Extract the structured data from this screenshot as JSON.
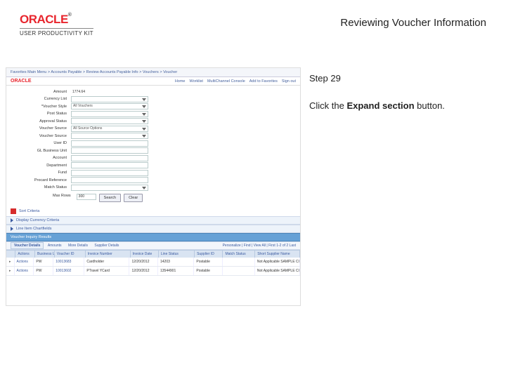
{
  "header": {
    "brand": "ORACLE",
    "brand_tm": "®",
    "subbrand": "USER PRODUCTIVITY KIT",
    "title": "Reviewing Voucher Information"
  },
  "side": {
    "step_label": "Step 29",
    "instruction_pre": "Click the ",
    "instruction_bold": "Expand section",
    "instruction_post": " button."
  },
  "shot": {
    "breadcrumb": "Favorites    Main Menu  >  Accounts Payable  >  Review Accounts Payable Info  >  Vouchers  >  Voucher",
    "brand_small": "ORACLE",
    "toplinks": [
      "Home",
      "Worklist",
      "MultiChannel Console",
      "Add to Favorites",
      "Sign out"
    ],
    "form": [
      {
        "label": "Amount",
        "value": "1774.64",
        "type": "ro"
      },
      {
        "label": "Currency List",
        "type": "sel",
        "value": ""
      },
      {
        "label": "*Voucher Style",
        "type": "sel",
        "value": "All Vouchers"
      },
      {
        "label": "Post Status",
        "type": "sel",
        "value": ""
      },
      {
        "label": "Approval Status",
        "type": "sel",
        "value": ""
      },
      {
        "label": "Voucher Source",
        "type": "sel",
        "value": "All Source Options"
      },
      {
        "label": "Voucher Source",
        "type": "sel",
        "value": ""
      },
      {
        "label": "User ID",
        "type": "input",
        "value": ""
      },
      {
        "label": "GL Business Unit",
        "type": "input",
        "value": ""
      },
      {
        "label": "Account",
        "type": "input",
        "value": ""
      },
      {
        "label": "Department",
        "type": "input",
        "value": ""
      },
      {
        "label": "Fund",
        "type": "input",
        "value": ""
      },
      {
        "label": "Procard Reference",
        "type": "input",
        "value": ""
      },
      {
        "label": "Match Status",
        "type": "sel",
        "value": ""
      }
    ],
    "buttons": {
      "rows": "Max Rows",
      "rows_val": "300",
      "search": "Search",
      "clear": "Clear"
    },
    "sort_header": "Sort Criteria",
    "disp_label": "Display Currency Criteria",
    "chart_label": "Line Item Chartfields",
    "grid_title": "Voucher Inquiry Results",
    "grid_toolbar_left": "Personalize | Find | View All | ",
    "grid_toolbar_right": "First   1-2 of 2   Last",
    "grid_tabs": [
      "Voucher Details",
      "Amounts",
      "More Details",
      "Supplier Details"
    ],
    "columns": [
      "",
      "Actions",
      "Business Unit",
      "Voucher ID",
      "Invoice Number",
      "Invoice Date",
      "Line Status",
      "Supplier ID",
      "Match Status",
      "Short Supplier Name"
    ],
    "rows": [
      [
        "▸",
        "Actions",
        "PW",
        "10013683",
        "Cardholder",
        "12/20/2012",
        "14203",
        "Postable",
        "",
        "Not Applicable  SAMPLE CITY Corp"
      ],
      [
        "▸",
        "Actions",
        "PW",
        "10013602",
        "PTravel YCard",
        "12/20/2012",
        "13544901",
        "Postable",
        "",
        "Not Applicable  SAMPLE CITY Corp"
      ]
    ]
  }
}
